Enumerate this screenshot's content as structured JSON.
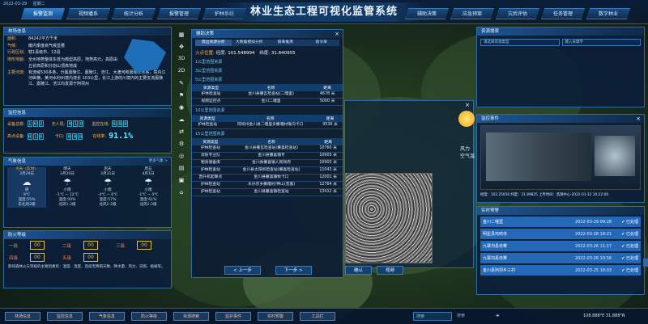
{
  "header": {
    "date": "2022-03-29",
    "weekday": "星期二",
    "title": "林业生态工程可视化监管系统",
    "left_tabs": [
      "报警监测",
      "视频播系",
      "统计分析",
      "报警管理",
      "护林系统"
    ],
    "right_tabs": [
      "辅助决策",
      "应急预案",
      "灾后评估",
      "任务管理",
      "数字林业"
    ]
  },
  "forest_info": {
    "title": "林场信息",
    "area_label": "面积:",
    "area_value": "84242平方千米",
    "climate_label": "气候:",
    "climate_value": "暖内季度高气候显著",
    "admin_label": "行政区划:",
    "admin_value": "辖1县级市、12县",
    "terrain_label": "地形地貌:",
    "terrain_value": "全州地势整体东低为典型高原，地势高元，高原由丘状高原和分割山顶高地成",
    "rivers_label": "主要河流:",
    "rivers_value": "有流域530多条，分属嘉陵江、嘉陵江、涪江、大渡河和嘉陵江水系，境内江河纵横，黄河水利州境内流长 103公里，长江上游的川境内的主要支流嘉陵江、嘉陵江、涪江均发源于阿坝州"
  },
  "monitor": {
    "title": "监控信息",
    "device_label": "设备总数:",
    "device_digits": [
      "1",
      "0",
      "3"
    ],
    "drone_label": "无人机:",
    "drone_digits": [
      "0",
      "1",
      "0"
    ],
    "camera_label": "监控在线:",
    "camera_digits": [
      "8",
      "8",
      "8"
    ],
    "highpoint_label": "高点设备:",
    "highpoint_digits": [
      "0",
      "1",
      "0"
    ],
    "bayonet_label": "卡口:",
    "bayonet_digits": [
      "0",
      "0",
      "0"
    ],
    "online_label": "在线率:",
    "online_rate": "91.1%"
  },
  "weather": {
    "title": "气象信息",
    "more": "更多气象 >",
    "days": [
      {
        "day": "今天（实时）",
        "date": "3月29日",
        "icon": "cloud-icon",
        "cond": "阴",
        "temp": "9℃",
        "extra1": "湿度:55%",
        "extra2": "东北风2级"
      },
      {
        "day": "明天",
        "date": "3月30日",
        "icon": "rain-icon",
        "cond": "小雨",
        "temp": "-1℃ ~ 12℃",
        "extra1": "湿度:50%",
        "extra2": "北风1-2级"
      },
      {
        "day": "后天",
        "date": "3月31日",
        "icon": "rain-icon",
        "cond": "小雨",
        "temp": "-4℃ ~ 6℃",
        "extra1": "湿度:57%",
        "extra2": "北风1-2级"
      },
      {
        "day": "周五",
        "date": "4月1日",
        "icon": "rain-icon",
        "cond": "小雨",
        "temp": "-1℃ ~ 4℃",
        "extra1": "湿度:61%",
        "extra2": "北风1-2级"
      }
    ]
  },
  "fire_level": {
    "title": "防火等级",
    "row1": [
      {
        "label": "一级",
        "digits": "00"
      },
      {
        "label": "二级",
        "digits": "00"
      },
      {
        "label": "三级",
        "digits": "00"
      }
    ],
    "row2": [
      {
        "label": "四级",
        "digits": "00"
      },
      {
        "label": "五级",
        "digits": "00"
      }
    ],
    "note": "影响森林火灾等级的主要因素有：温度、湿度、连续无降雨天数、降水量、风力、日照、植被等。"
  },
  "decision": {
    "title": "辅助决策",
    "tabs": [
      "周边资源分析",
      "大数据模拟分析",
      "隔离推演",
      "指令单"
    ],
    "loc_label": "火点位置:",
    "lon_label": "经度:",
    "lon_value": "101.548994",
    "lat_label": "纬度:",
    "lat_value": "31.840955",
    "col_type": "资源类型",
    "col_name": "名称",
    "col_dist": "距离",
    "sections": [
      {
        "title": "1公里范围资源",
        "rows": []
      },
      {
        "title": "3公里范围资源",
        "rows": []
      },
      {
        "title": "5公里范围资源",
        "rows": [
          {
            "type": "护林检查站",
            "name": "金川县撒瓦检查站(二嘎里)",
            "dist": "4678 米"
          },
          {
            "type": "视频监控点",
            "name": "金川二嘎里",
            "dist": "5000 米"
          }
        ]
      },
      {
        "title": "10公里范围资源",
        "rows": [
          {
            "type": "护林检查站",
            "name": "阿坝州金川县二嘎里多撒嘎村喉沟卡口",
            "dist": "9536 米"
          }
        ]
      },
      {
        "title": "15公里范围资源",
        "rows": [
          {
            "type": "护林检查站",
            "name": "金川县撒瓦检查站(撒喜检查站)",
            "dist": "10760 米"
          },
          {
            "type": "消防专业队",
            "name": "金川县撒喜镇专",
            "dist": "10903 米"
          },
          {
            "type": "物资储备库",
            "name": "金川县撒喜镇人民政府",
            "dist": "10903 米"
          },
          {
            "type": "护林检查站",
            "name": "金川县太阳坝检查站(撒喜检查站)",
            "dist": "11043 米"
          },
          {
            "type": "直升机起降点",
            "name": "金川县撒喜镇牧卡口",
            "dist": "12001 米"
          },
          {
            "type": "护林检查站",
            "name": "木尔宗乡撒嘎村/神山(曾嘉)",
            "dist": "12764 米"
          },
          {
            "type": "护林检查站",
            "name": "金川县撒喜镇检查站",
            "dist": "13412 米"
          }
        ]
      }
    ],
    "prev": "< 上一步",
    "next": "下一步 >"
  },
  "resource_search": {
    "title": "资源搜索",
    "select_placeholder": "请选择资源类型",
    "keyword_placeholder": "输入关键字"
  },
  "monitor_event": {
    "title": "监控事件",
    "caption": "经度：102.25056  纬度：31.89825  上传时间：监测中心-2022-01-12 10:22:00"
  },
  "realtime_alerts": {
    "title": "实时预警",
    "items": [
      {
        "name": "金川二嘎里",
        "time": "2022-03-29 09:28",
        "status": "已处理"
      },
      {
        "name": "明星县鸡鸣寺",
        "time": "2022-03-28 18:21",
        "status": "已处理"
      },
      {
        "name": "九寨沟县赤雾",
        "time": "2022-03-26 11:17",
        "status": "已处理"
      },
      {
        "name": "九寨沟县赤雾",
        "time": "2022-03-26 10:56",
        "status": "已处理"
      },
      {
        "name": "金川县阿坝乡三村",
        "time": "2022-03-25 18:03",
        "status": "已处理"
      }
    ]
  },
  "midpanel": {
    "title": "风力",
    "line": "空气温"
  },
  "video_buttons": {
    "confirm": "确认",
    "video": "视频"
  },
  "footer": {
    "tabs": [
      "林场信息",
      "监控信息",
      "气象信息",
      "防火等级",
      "资源搜索",
      "监护事件",
      "实时预警",
      "工具栏"
    ],
    "search_placeholder": "搜索",
    "label2": "搜索",
    "coords": "108.888°E  31.888°N"
  },
  "colors": {
    "accent": "#2f6aa8",
    "warn": "#ffb24a",
    "cyan": "#5ff0ff",
    "alert_blue": "#2568b8"
  }
}
